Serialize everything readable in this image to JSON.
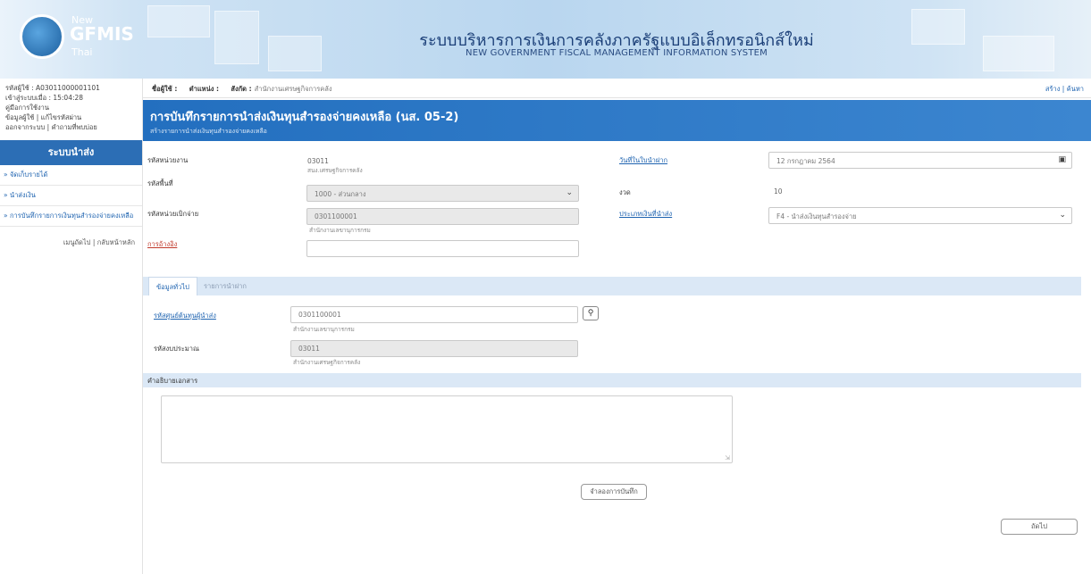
{
  "header": {
    "logo_new": "New",
    "logo_gfmis": "GFMIS",
    "logo_thai": "Thai",
    "title_th": "ระบบบริหารการเงินการคลังภาครัฐแบบอิเล็กทรอนิกส์ใหม่",
    "title_en": "NEW GOVERNMENT FISCAL MANAGEMENT INFORMATION SYSTEM"
  },
  "sidebar": {
    "user_code": "รหัสผู้ใช้ : A03011000001101",
    "login_time": "เข้าสู่ระบบเมื่อ : 15:04:28",
    "manual": "คู่มือการใช้งาน",
    "user_info": "ข้อมูลผู้ใช้",
    "change_password": "แก้ไขรหัสผ่าน",
    "logout": "ออกจากระบบ",
    "faq": "คำถามที่พบบ่อย",
    "menu_title": "ระบบนำส่ง",
    "items": [
      "» จัดเก็บรายได้",
      "» นำส่งเงิน",
      "» การบันทึกรายการเงินทุนสำรองจ่ายคงเหลือ"
    ],
    "footer_menu": "เมนูถัดไป",
    "footer_home": "กลับหน้าหลัก"
  },
  "crumb": {
    "user_label": "ชื่อผู้ใช้ :",
    "user_value": "",
    "position_label": "ตำแหน่ง :",
    "position_value": "",
    "org_label": "สังกัด :",
    "org_value": "สำนักงานเศรษฐกิจการคลัง",
    "link_create": "สร้าง",
    "link_search": "ค้นหา"
  },
  "banner": {
    "title": "การบันทึกรายการนำส่งเงินทุนสำรองจ่ายคงเหลือ (นส. 05-2)",
    "subtitle": "สร้างรายการนำส่งเงินทุนสำรองจ่ายคงเหลือ"
  },
  "form": {
    "agency_label": "รหัสหน่วยงาน",
    "agency_code": "03011",
    "agency_name": "สนง.เศรษฐกิจการคลัง",
    "area_label": "รหัสพื้นที่",
    "area_value": "1000 - ส่วนกลาง",
    "disb_label": "รหัสหน่วยเบิกจ่าย",
    "disb_value": "0301100001",
    "disb_name": "สำนักงานเลขานุการกรม",
    "ref_label": "การอ้างอิง",
    "ref_value": "",
    "doc_date_label": "วันที่ในใบนำฝาก",
    "doc_date_value": "12 กรกฎาคม 2564",
    "period_label": "งวด",
    "period_value": "10",
    "type_label": "ประเภทเงินที่นำส่ง",
    "type_value": "F4 - นำส่งเงินทุนสำรองจ่าย"
  },
  "tabs": {
    "general": "ข้อมูลทั่วไป",
    "items": "รายการนำฝาก"
  },
  "general": {
    "fund_center_label": "รหัสศูนย์ต้นทุนผู้นำส่ง",
    "fund_center_value": "0301100001",
    "fund_center_name": "สำนักงานเลขานุการกรม",
    "budget_label": "รหัสงบประมาณ",
    "budget_value": "03011",
    "budget_name": "สำนักงานเศรษฐกิจการคลัง",
    "desc_label": "คำอธิบายเอกสาร",
    "desc_value": ""
  },
  "buttons": {
    "save_label": "จำลองการบันทึก",
    "next_label": "ถัดไป"
  }
}
